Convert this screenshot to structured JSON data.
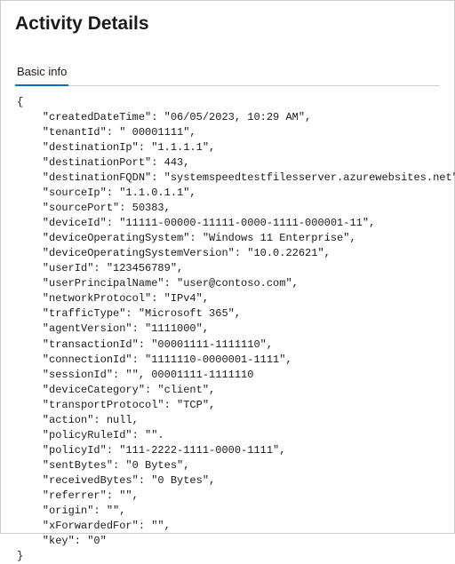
{
  "header": {
    "title": "Activity Details"
  },
  "tabs": {
    "basic_info": "Basic info"
  },
  "details": {
    "createdDateTime": "06/05/2023, 10:29 AM",
    "tenantId": " 00001111",
    "destinationIp": "1.1.1.1",
    "destinationPort": 443,
    "destinationFQDN": "systemspeedtestfilesserver.azurewebsites.net",
    "sourceIp": "1.1.0.1.1",
    "sourcePort": 50383,
    "deviceId": "11111-00000-11111-0000-1111-000001-11",
    "deviceOperatingSystem": "Windows 11 Enterprise",
    "deviceOperatingSystemVersion": "10.0.22621",
    "userId": "123456789",
    "userPrincipalName": "user@contoso.com",
    "networkProtocol": "IPv4",
    "trafficType": "Microsoft 365",
    "agentVersion": "1111000",
    "transactionId": "00001111-1111110",
    "connectionId": "1111110-0000001-1111",
    "sessionId_raw": "\"\", 00001111-1111110",
    "deviceCategory": "client",
    "transportProtocol": "TCP",
    "action": null,
    "policyRuleId_raw": "\"\".",
    "policyId": "111-2222-1111-0000-1111",
    "sentBytes": "0 Bytes",
    "receivedBytes": "0 Bytes",
    "referrer": "",
    "origin": "",
    "xForwardedFor": "",
    "key": "0"
  }
}
